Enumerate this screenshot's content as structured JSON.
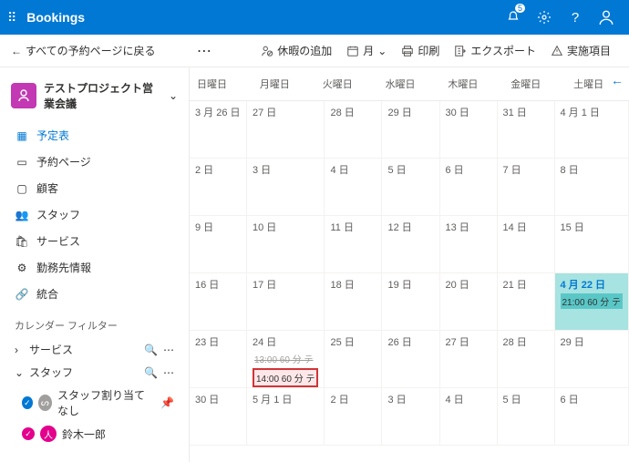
{
  "appbar": {
    "title": "Bookings",
    "notif_count": "5"
  },
  "back_label": "すべての予約ページに戻る",
  "project_name": "テストプロジェクト営業会議",
  "nav": {
    "schedule": "予定表",
    "booking_page": "予約ページ",
    "customers": "顧客",
    "staff": "スタッフ",
    "services": "サービス",
    "business_info": "勤務先情報",
    "integrations": "統合"
  },
  "filter_title": "カレンダー フィルター",
  "filter_services": "サービス",
  "filter_staff": "スタッフ",
  "staff_unassigned": "スタッフ割り当てなし",
  "staff_member": "鈴木一郎",
  "cmd": {
    "add_timeoff": "休暇の追加",
    "month": "月",
    "print": "印刷",
    "export": "エクスポート",
    "actions": "実施項目"
  },
  "dow": [
    "日曜日",
    "月曜日",
    "火曜日",
    "水曜日",
    "木曜日",
    "金曜日",
    "土曜日"
  ],
  "dates": {
    "r0": [
      "3 月 26 日",
      "27 日",
      "28 日",
      "29 日",
      "30 日",
      "31 日",
      "4 月 1 日"
    ],
    "r1": [
      "2 日",
      "3 日",
      "4 日",
      "5 日",
      "6 日",
      "7 日",
      "8 日"
    ],
    "r2": [
      "9 日",
      "10 日",
      "11 日",
      "12 日",
      "13 日",
      "14 日",
      "15 日"
    ],
    "r3": [
      "16 日",
      "17 日",
      "18 日",
      "19 日",
      "20 日",
      "21 日",
      "4 月 22 日"
    ],
    "r4": [
      "23 日",
      "24 日",
      "25 日",
      "26 日",
      "27 日",
      "28 日",
      "29 日"
    ],
    "r5": [
      "30 日",
      "5 月 1 日",
      "2 日",
      "3 日",
      "4 日",
      "5 日",
      "6 日"
    ]
  },
  "events": {
    "apr22": "21:00 60 分 テ",
    "apr24a": "13:00 60 分 テ",
    "apr24b": "14:00 60 分 テ"
  }
}
